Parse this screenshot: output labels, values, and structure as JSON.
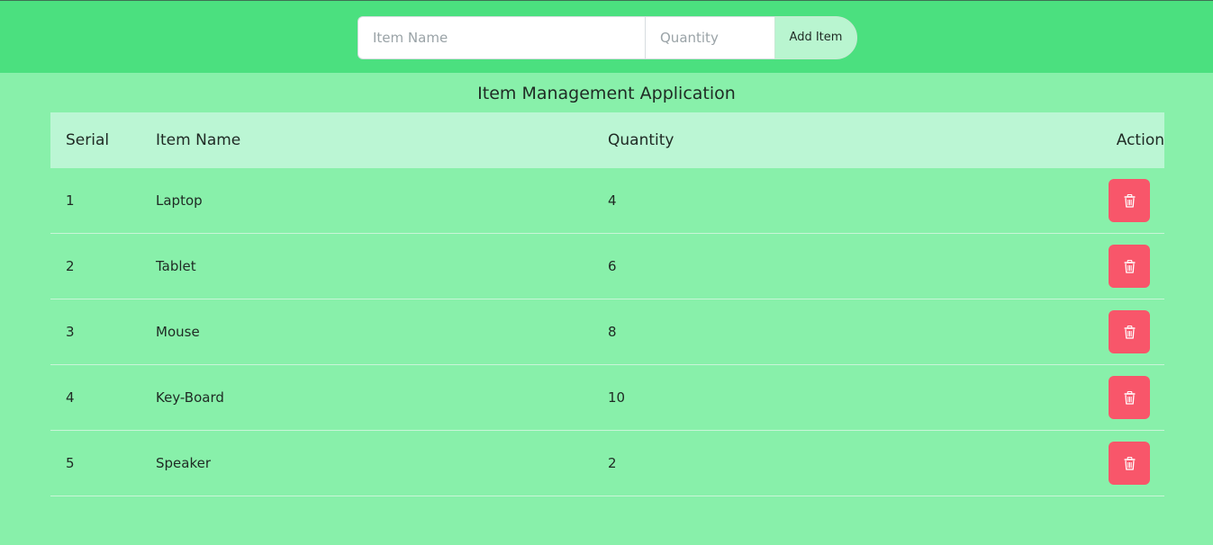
{
  "form": {
    "item_name_placeholder": "Item Name",
    "item_name_value": "",
    "quantity_placeholder": "Quantity",
    "quantity_value": "",
    "add_button_label": "Add Item"
  },
  "page_title": "Item Management Application",
  "table": {
    "headers": {
      "serial": "Serial",
      "item_name": "Item Name",
      "quantity": "Quantity",
      "action": "Action"
    },
    "rows": [
      {
        "serial": "1",
        "item_name": "Laptop",
        "quantity": "4",
        "action_icon": "trash-icon"
      },
      {
        "serial": "2",
        "item_name": "Tablet",
        "quantity": "6",
        "action_icon": "trash-icon"
      },
      {
        "serial": "3",
        "item_name": "Mouse",
        "quantity": "8",
        "action_icon": "trash-icon"
      },
      {
        "serial": "4",
        "item_name": "Key-Board",
        "quantity": "10",
        "action_icon": "trash-icon"
      },
      {
        "serial": "5",
        "item_name": "Speaker",
        "quantity": "2",
        "action_icon": "trash-icon"
      }
    ]
  },
  "colors": {
    "header_bar": "#4be07f",
    "page_background": "#88f0aa",
    "table_header": "#bbf6d4",
    "add_button": "#b9f5d0",
    "delete_button": "#f8566a"
  }
}
